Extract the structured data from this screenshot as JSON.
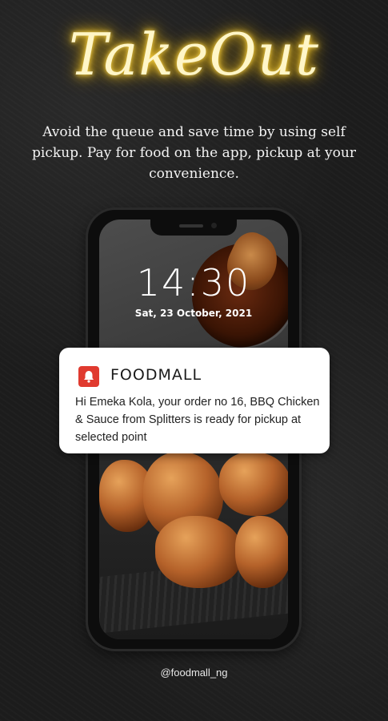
{
  "header": {
    "title": "TakeOut",
    "subtitle": "Avoid the queue and save time by using self pickup. Pay for food on the app, pickup at your convenience."
  },
  "lockscreen": {
    "time": "14:30",
    "date": "Sat, 23 October, 2021"
  },
  "notification": {
    "app_icon": "bell-icon",
    "app_name": "FOODMALL",
    "message": "Hi Emeka Kola, your order no 16, BBQ Chicken & Sauce from Splitters is ready for pickup at selected point"
  },
  "footer": {
    "handle": "@foodmall_ng"
  },
  "colors": {
    "neon_title": "#ffd94a",
    "app_icon_bg": "#e03a2f",
    "background": "#1c1c1c"
  }
}
